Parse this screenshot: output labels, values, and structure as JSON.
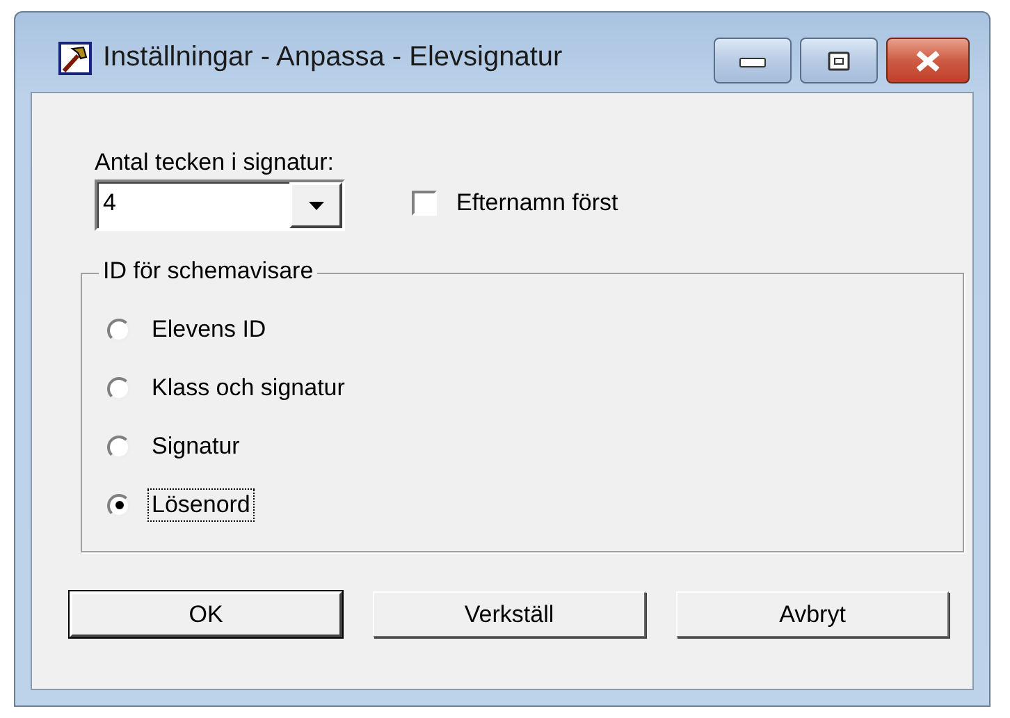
{
  "window": {
    "title": "Inställningar - Anpassa - Elevsignatur"
  },
  "signature_length": {
    "label": "Antal tecken i signatur:",
    "value": "4"
  },
  "surname_first": {
    "label": "Efternamn först",
    "checked": false
  },
  "id_group": {
    "title": "ID för schemavisare",
    "options": [
      {
        "label": "Elevens ID",
        "selected": false,
        "focused": false
      },
      {
        "label": "Klass och signatur",
        "selected": false,
        "focused": false
      },
      {
        "label": "Signatur",
        "selected": false,
        "focused": false
      },
      {
        "label": "Lösenord",
        "selected": true,
        "focused": true
      }
    ]
  },
  "buttons": [
    {
      "label": "OK",
      "default": true
    },
    {
      "label": "Verkställ",
      "default": false
    },
    {
      "label": "Avbryt",
      "default": false
    }
  ]
}
